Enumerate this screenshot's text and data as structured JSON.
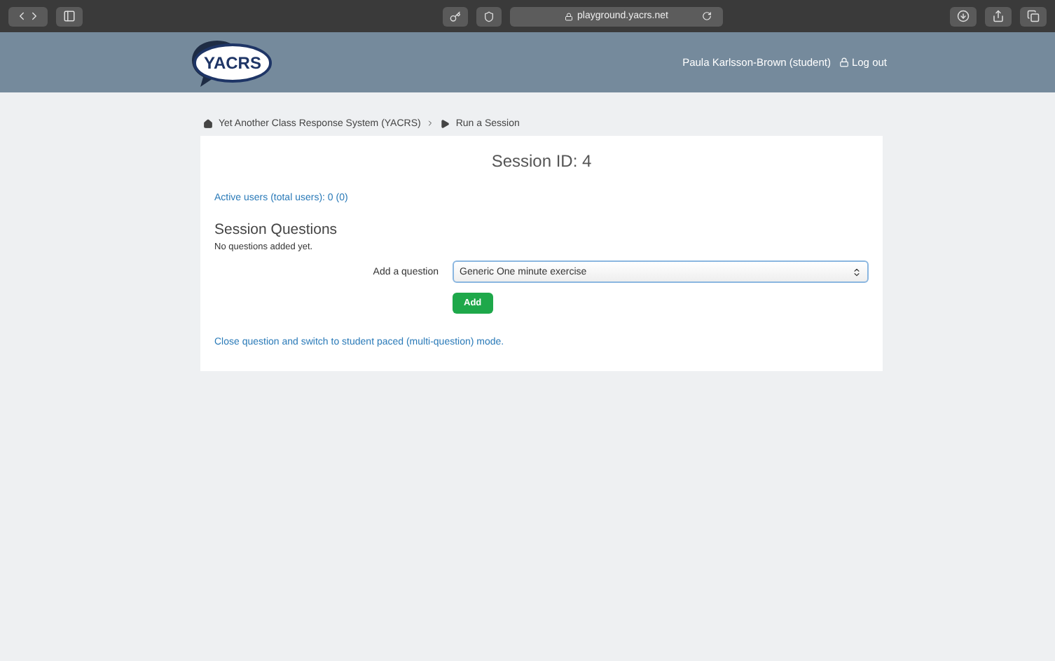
{
  "browser": {
    "url": "playground.yacrs.net"
  },
  "header": {
    "logo": "YACRS",
    "user": "Paula Karlsson-Brown (student)",
    "logout": "Log out"
  },
  "breadcrumb": [
    {
      "label": "Yet Another Class Response System (YACRS)"
    },
    {
      "label": "Run a Session"
    }
  ],
  "card": {
    "title": "Session ID: 4",
    "active_users": "Active users (total users): 0 (0)",
    "section_title": "Session Questions",
    "empty_note": "No questions added yet.",
    "add_label": "Add a question",
    "select_value": "Generic One minute exercise",
    "add_button": "Add",
    "mode_link": "Close question and switch to student paced (multi-question) mode."
  }
}
